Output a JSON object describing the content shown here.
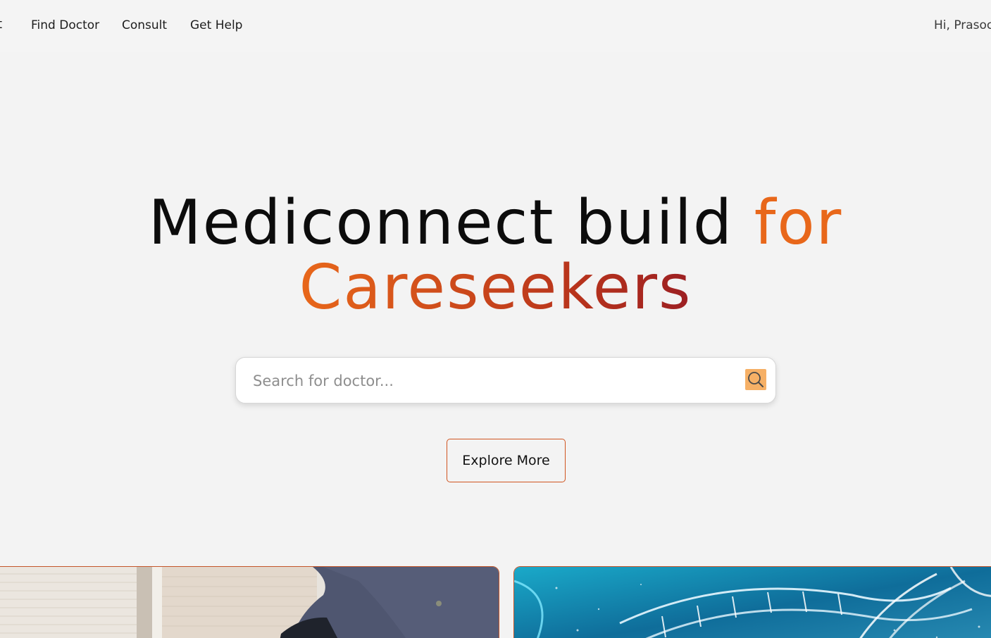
{
  "nav": {
    "brand_fragment": "t",
    "links": [
      {
        "label": "Find Doctor"
      },
      {
        "label": "Consult"
      },
      {
        "label": "Get Help"
      }
    ],
    "greeting": "Hi, Prasoc"
  },
  "hero": {
    "title_part1": "Mediconnect build ",
    "title_accent": "for",
    "title_line2": "Careseekers",
    "accent_color": "#e8671a"
  },
  "search": {
    "placeholder": "Search for doctor...",
    "value": "",
    "icon": "search-icon",
    "button_color": "#f6b066"
  },
  "explore": {
    "label": "Explore More",
    "border_color": "#d0541f"
  },
  "cards": [
    {
      "image": "patient-photo",
      "icon": "photo"
    },
    {
      "image": "dna-helix-photo",
      "icon": "photo"
    }
  ]
}
